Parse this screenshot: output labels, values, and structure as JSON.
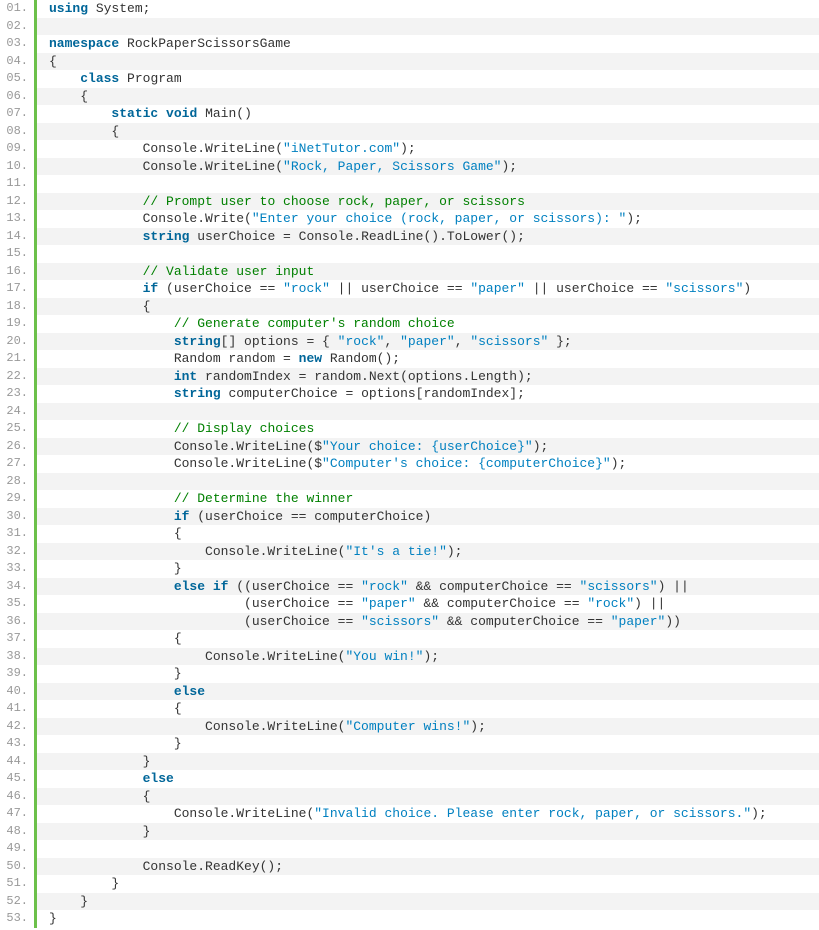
{
  "lines": [
    {
      "num": "01.",
      "tokens": [
        {
          "t": "kw",
          "s": "using"
        },
        {
          "t": "txt",
          "s": " System;"
        }
      ]
    },
    {
      "num": "02.",
      "tokens": []
    },
    {
      "num": "03.",
      "tokens": [
        {
          "t": "kw",
          "s": "namespace"
        },
        {
          "t": "txt",
          "s": " RockPaperScissorsGame"
        }
      ]
    },
    {
      "num": "04.",
      "tokens": [
        {
          "t": "txt",
          "s": "{"
        }
      ]
    },
    {
      "num": "05.",
      "tokens": [
        {
          "t": "txt",
          "s": "    "
        },
        {
          "t": "kw",
          "s": "class"
        },
        {
          "t": "txt",
          "s": " Program"
        }
      ]
    },
    {
      "num": "06.",
      "tokens": [
        {
          "t": "txt",
          "s": "    {"
        }
      ]
    },
    {
      "num": "07.",
      "tokens": [
        {
          "t": "txt",
          "s": "        "
        },
        {
          "t": "kw",
          "s": "static"
        },
        {
          "t": "txt",
          "s": " "
        },
        {
          "t": "kw",
          "s": "void"
        },
        {
          "t": "txt",
          "s": " Main()"
        }
      ]
    },
    {
      "num": "08.",
      "tokens": [
        {
          "t": "txt",
          "s": "        {"
        }
      ]
    },
    {
      "num": "09.",
      "tokens": [
        {
          "t": "txt",
          "s": "            Console.WriteLine("
        },
        {
          "t": "str",
          "s": "\"iNetTutor.com\""
        },
        {
          "t": "txt",
          "s": ");"
        }
      ]
    },
    {
      "num": "10.",
      "tokens": [
        {
          "t": "txt",
          "s": "            Console.WriteLine("
        },
        {
          "t": "str",
          "s": "\"Rock, Paper, Scissors Game\""
        },
        {
          "t": "txt",
          "s": ");"
        }
      ]
    },
    {
      "num": "11.",
      "tokens": []
    },
    {
      "num": "12.",
      "tokens": [
        {
          "t": "txt",
          "s": "            "
        },
        {
          "t": "com",
          "s": "// Prompt user to choose rock, paper, or scissors"
        }
      ]
    },
    {
      "num": "13.",
      "tokens": [
        {
          "t": "txt",
          "s": "            Console.Write("
        },
        {
          "t": "str",
          "s": "\"Enter your choice (rock, paper, or scissors): \""
        },
        {
          "t": "txt",
          "s": ");"
        }
      ]
    },
    {
      "num": "14.",
      "tokens": [
        {
          "t": "txt",
          "s": "            "
        },
        {
          "t": "kw",
          "s": "string"
        },
        {
          "t": "txt",
          "s": " userChoice = Console.ReadLine().ToLower();"
        }
      ]
    },
    {
      "num": "15.",
      "tokens": []
    },
    {
      "num": "16.",
      "tokens": [
        {
          "t": "txt",
          "s": "            "
        },
        {
          "t": "com",
          "s": "// Validate user input"
        }
      ]
    },
    {
      "num": "17.",
      "tokens": [
        {
          "t": "txt",
          "s": "            "
        },
        {
          "t": "kw",
          "s": "if"
        },
        {
          "t": "txt",
          "s": " (userChoice == "
        },
        {
          "t": "str",
          "s": "\"rock\""
        },
        {
          "t": "txt",
          "s": " || userChoice == "
        },
        {
          "t": "str",
          "s": "\"paper\""
        },
        {
          "t": "txt",
          "s": " || userChoice == "
        },
        {
          "t": "str",
          "s": "\"scissors\""
        },
        {
          "t": "txt",
          "s": ")"
        }
      ]
    },
    {
      "num": "18.",
      "tokens": [
        {
          "t": "txt",
          "s": "            {"
        }
      ]
    },
    {
      "num": "19.",
      "tokens": [
        {
          "t": "txt",
          "s": "                "
        },
        {
          "t": "com",
          "s": "// Generate computer's random choice"
        }
      ]
    },
    {
      "num": "20.",
      "tokens": [
        {
          "t": "txt",
          "s": "                "
        },
        {
          "t": "kw",
          "s": "string"
        },
        {
          "t": "txt",
          "s": "[] options = { "
        },
        {
          "t": "str",
          "s": "\"rock\""
        },
        {
          "t": "txt",
          "s": ", "
        },
        {
          "t": "str",
          "s": "\"paper\""
        },
        {
          "t": "txt",
          "s": ", "
        },
        {
          "t": "str",
          "s": "\"scissors\""
        },
        {
          "t": "txt",
          "s": " };"
        }
      ]
    },
    {
      "num": "21.",
      "tokens": [
        {
          "t": "txt",
          "s": "                Random random = "
        },
        {
          "t": "kw",
          "s": "new"
        },
        {
          "t": "txt",
          "s": " Random();"
        }
      ]
    },
    {
      "num": "22.",
      "tokens": [
        {
          "t": "txt",
          "s": "                "
        },
        {
          "t": "kw",
          "s": "int"
        },
        {
          "t": "txt",
          "s": " randomIndex = random.Next(options.Length);"
        }
      ]
    },
    {
      "num": "23.",
      "tokens": [
        {
          "t": "txt",
          "s": "                "
        },
        {
          "t": "kw",
          "s": "string"
        },
        {
          "t": "txt",
          "s": " computerChoice = options[randomIndex];"
        }
      ]
    },
    {
      "num": "24.",
      "tokens": []
    },
    {
      "num": "25.",
      "tokens": [
        {
          "t": "txt",
          "s": "                "
        },
        {
          "t": "com",
          "s": "// Display choices"
        }
      ]
    },
    {
      "num": "26.",
      "tokens": [
        {
          "t": "txt",
          "s": "                Console.WriteLine($"
        },
        {
          "t": "str",
          "s": "\"Your choice: {userChoice}\""
        },
        {
          "t": "txt",
          "s": ");"
        }
      ]
    },
    {
      "num": "27.",
      "tokens": [
        {
          "t": "txt",
          "s": "                Console.WriteLine($"
        },
        {
          "t": "str",
          "s": "\"Computer's choice: {computerChoice}\""
        },
        {
          "t": "txt",
          "s": ");"
        }
      ]
    },
    {
      "num": "28.",
      "tokens": []
    },
    {
      "num": "29.",
      "tokens": [
        {
          "t": "txt",
          "s": "                "
        },
        {
          "t": "com",
          "s": "// Determine the winner"
        }
      ]
    },
    {
      "num": "30.",
      "tokens": [
        {
          "t": "txt",
          "s": "                "
        },
        {
          "t": "kw",
          "s": "if"
        },
        {
          "t": "txt",
          "s": " (userChoice == computerChoice)"
        }
      ]
    },
    {
      "num": "31.",
      "tokens": [
        {
          "t": "txt",
          "s": "                {"
        }
      ]
    },
    {
      "num": "32.",
      "tokens": [
        {
          "t": "txt",
          "s": "                    Console.WriteLine("
        },
        {
          "t": "str",
          "s": "\"It's a tie!\""
        },
        {
          "t": "txt",
          "s": ");"
        }
      ]
    },
    {
      "num": "33.",
      "tokens": [
        {
          "t": "txt",
          "s": "                }"
        }
      ]
    },
    {
      "num": "34.",
      "tokens": [
        {
          "t": "txt",
          "s": "                "
        },
        {
          "t": "kw",
          "s": "else"
        },
        {
          "t": "txt",
          "s": " "
        },
        {
          "t": "kw",
          "s": "if"
        },
        {
          "t": "txt",
          "s": " ((userChoice == "
        },
        {
          "t": "str",
          "s": "\"rock\""
        },
        {
          "t": "txt",
          "s": " && computerChoice == "
        },
        {
          "t": "str",
          "s": "\"scissors\""
        },
        {
          "t": "txt",
          "s": ") ||"
        }
      ]
    },
    {
      "num": "35.",
      "tokens": [
        {
          "t": "txt",
          "s": "                         (userChoice == "
        },
        {
          "t": "str",
          "s": "\"paper\""
        },
        {
          "t": "txt",
          "s": " && computerChoice == "
        },
        {
          "t": "str",
          "s": "\"rock\""
        },
        {
          "t": "txt",
          "s": ") ||"
        }
      ]
    },
    {
      "num": "36.",
      "tokens": [
        {
          "t": "txt",
          "s": "                         (userChoice == "
        },
        {
          "t": "str",
          "s": "\"scissors\""
        },
        {
          "t": "txt",
          "s": " && computerChoice == "
        },
        {
          "t": "str",
          "s": "\"paper\""
        },
        {
          "t": "txt",
          "s": "))"
        }
      ]
    },
    {
      "num": "37.",
      "tokens": [
        {
          "t": "txt",
          "s": "                {"
        }
      ]
    },
    {
      "num": "38.",
      "tokens": [
        {
          "t": "txt",
          "s": "                    Console.WriteLine("
        },
        {
          "t": "str",
          "s": "\"You win!\""
        },
        {
          "t": "txt",
          "s": ");"
        }
      ]
    },
    {
      "num": "39.",
      "tokens": [
        {
          "t": "txt",
          "s": "                }"
        }
      ]
    },
    {
      "num": "40.",
      "tokens": [
        {
          "t": "txt",
          "s": "                "
        },
        {
          "t": "kw",
          "s": "else"
        }
      ]
    },
    {
      "num": "41.",
      "tokens": [
        {
          "t": "txt",
          "s": "                {"
        }
      ]
    },
    {
      "num": "42.",
      "tokens": [
        {
          "t": "txt",
          "s": "                    Console.WriteLine("
        },
        {
          "t": "str",
          "s": "\"Computer wins!\""
        },
        {
          "t": "txt",
          "s": ");"
        }
      ]
    },
    {
      "num": "43.",
      "tokens": [
        {
          "t": "txt",
          "s": "                }"
        }
      ]
    },
    {
      "num": "44.",
      "tokens": [
        {
          "t": "txt",
          "s": "            }"
        }
      ]
    },
    {
      "num": "45.",
      "tokens": [
        {
          "t": "txt",
          "s": "            "
        },
        {
          "t": "kw",
          "s": "else"
        }
      ]
    },
    {
      "num": "46.",
      "tokens": [
        {
          "t": "txt",
          "s": "            {"
        }
      ]
    },
    {
      "num": "47.",
      "tokens": [
        {
          "t": "txt",
          "s": "                Console.WriteLine("
        },
        {
          "t": "str",
          "s": "\"Invalid choice. Please enter rock, paper, or scissors.\""
        },
        {
          "t": "txt",
          "s": ");"
        }
      ]
    },
    {
      "num": "48.",
      "tokens": [
        {
          "t": "txt",
          "s": "            }"
        }
      ]
    },
    {
      "num": "49.",
      "tokens": []
    },
    {
      "num": "50.",
      "tokens": [
        {
          "t": "txt",
          "s": "            Console.ReadKey();"
        }
      ]
    },
    {
      "num": "51.",
      "tokens": [
        {
          "t": "txt",
          "s": "        }"
        }
      ]
    },
    {
      "num": "52.",
      "tokens": [
        {
          "t": "txt",
          "s": "    }"
        }
      ]
    },
    {
      "num": "53.",
      "tokens": [
        {
          "t": "txt",
          "s": "}"
        }
      ]
    }
  ]
}
